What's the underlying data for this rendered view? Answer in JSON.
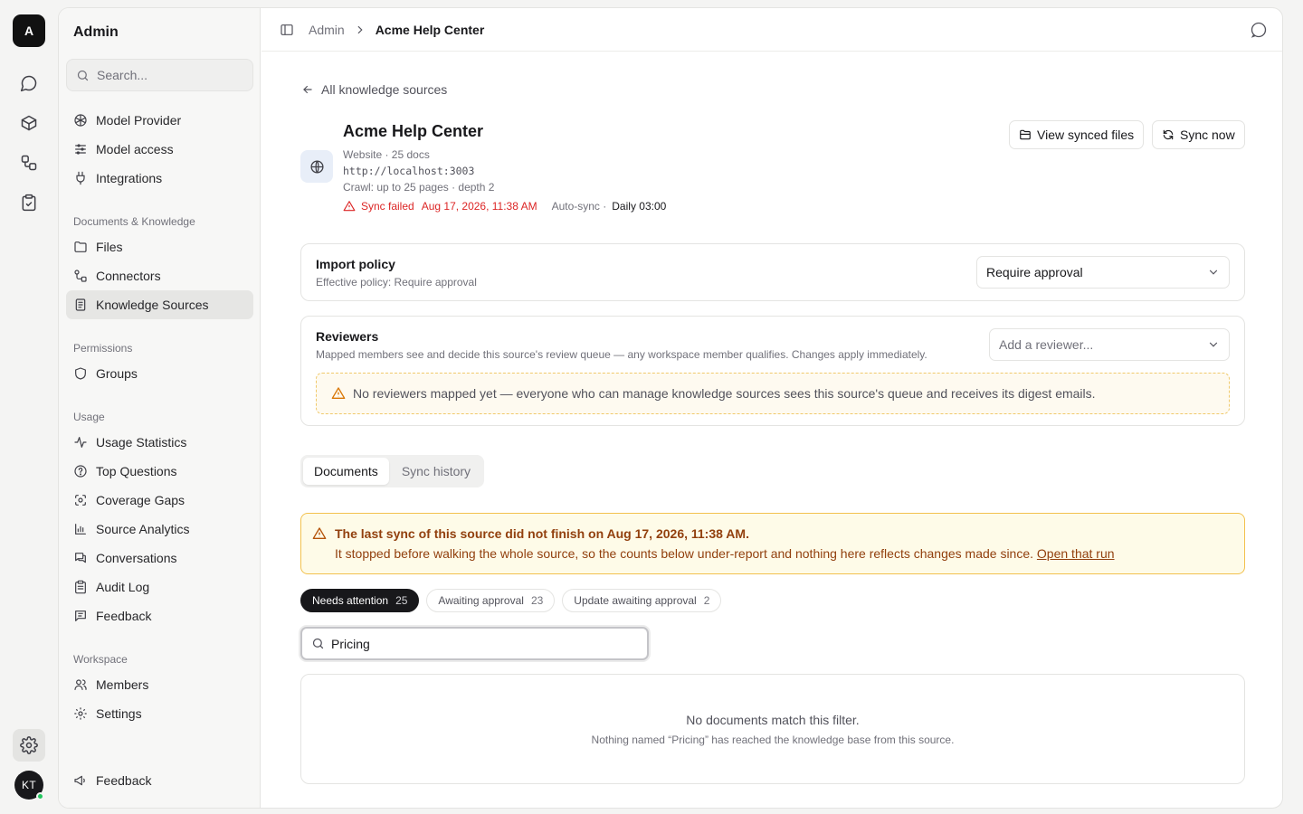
{
  "rail": {
    "logo": "A",
    "avatar": "KT"
  },
  "sidebar": {
    "title": "Admin",
    "search_placeholder": "Search...",
    "items_top": [
      {
        "label": "Model Provider",
        "icon": "model-provider-icon"
      },
      {
        "label": "Model access",
        "icon": "sliders-icon"
      },
      {
        "label": "Integrations",
        "icon": "plug-icon"
      }
    ],
    "group_documents": "Documents & Knowledge",
    "items_documents": [
      {
        "label": "Files",
        "icon": "folder-icon"
      },
      {
        "label": "Connectors",
        "icon": "connector-icon"
      },
      {
        "label": "Knowledge Sources",
        "icon": "book-icon"
      }
    ],
    "group_permissions": "Permissions",
    "items_permissions": [
      {
        "label": "Groups",
        "icon": "shield-icon"
      }
    ],
    "group_usage": "Usage",
    "items_usage": [
      {
        "label": "Usage Statistics",
        "icon": "activity-icon"
      },
      {
        "label": "Top Questions",
        "icon": "help-circle-icon"
      },
      {
        "label": "Coverage Gaps",
        "icon": "scan-icon"
      },
      {
        "label": "Source Analytics",
        "icon": "bar-chart-icon"
      },
      {
        "label": "Conversations",
        "icon": "messages-icon"
      },
      {
        "label": "Audit Log",
        "icon": "clipboard-icon"
      },
      {
        "label": "Feedback",
        "icon": "message-square-icon"
      }
    ],
    "group_workspace": "Workspace",
    "items_workspace": [
      {
        "label": "Members",
        "icon": "users-icon"
      },
      {
        "label": "Settings",
        "icon": "gear-icon"
      }
    ],
    "footer_feedback": "Feedback"
  },
  "breadcrumb": {
    "parent": "Admin",
    "current": "Acme Help Center"
  },
  "source": {
    "back_label": "All knowledge sources",
    "title": "Acme Help Center",
    "meta_line": "Website · 25 docs",
    "url": "http://localhost:3003",
    "crawl": "Crawl: up to 25 pages · depth 2",
    "sync_status": "Sync failed",
    "sync_time": "Aug 17, 2026, 11:38 AM",
    "auto_sync_label": "Auto-sync ·",
    "auto_sync_value": "Daily 03:00",
    "view_files_label": "View synced files",
    "sync_now_label": "Sync now"
  },
  "import_policy": {
    "title": "Import policy",
    "subtitle": "Effective policy: Require approval",
    "selected": "Require approval"
  },
  "reviewers": {
    "title": "Reviewers",
    "subtitle": "Mapped members see and decide this source's review queue — any workspace member qualifies. Changes apply immediately.",
    "placeholder": "Add a reviewer...",
    "warning": "No reviewers mapped yet — everyone who can manage knowledge sources sees this source's queue and receives its digest emails."
  },
  "tabs": [
    {
      "label": "Documents",
      "active": true
    },
    {
      "label": "Sync history",
      "active": false
    }
  ],
  "alert": {
    "title": "The last sync of this source did not finish on Aug 17, 2026, 11:38 AM.",
    "body": "It stopped before walking the whole source, so the counts below under-report and nothing here reflects changes made since.",
    "link": "Open that run"
  },
  "filters": [
    {
      "label": "Needs attention",
      "count": "25",
      "active": true
    },
    {
      "label": "Awaiting approval",
      "count": "23",
      "active": false
    },
    {
      "label": "Update awaiting approval",
      "count": "2",
      "active": false
    }
  ],
  "filter_input": {
    "value": "Pricing"
  },
  "empty_state": {
    "title": "No documents match this filter.",
    "subtitle": "Nothing named “Pricing” has reached the knowledge base from this source."
  },
  "colors": {
    "error": "#dc2626",
    "warning_border": "#f2c14e",
    "warning_text": "#92400e",
    "active_chip": "#18181b"
  }
}
